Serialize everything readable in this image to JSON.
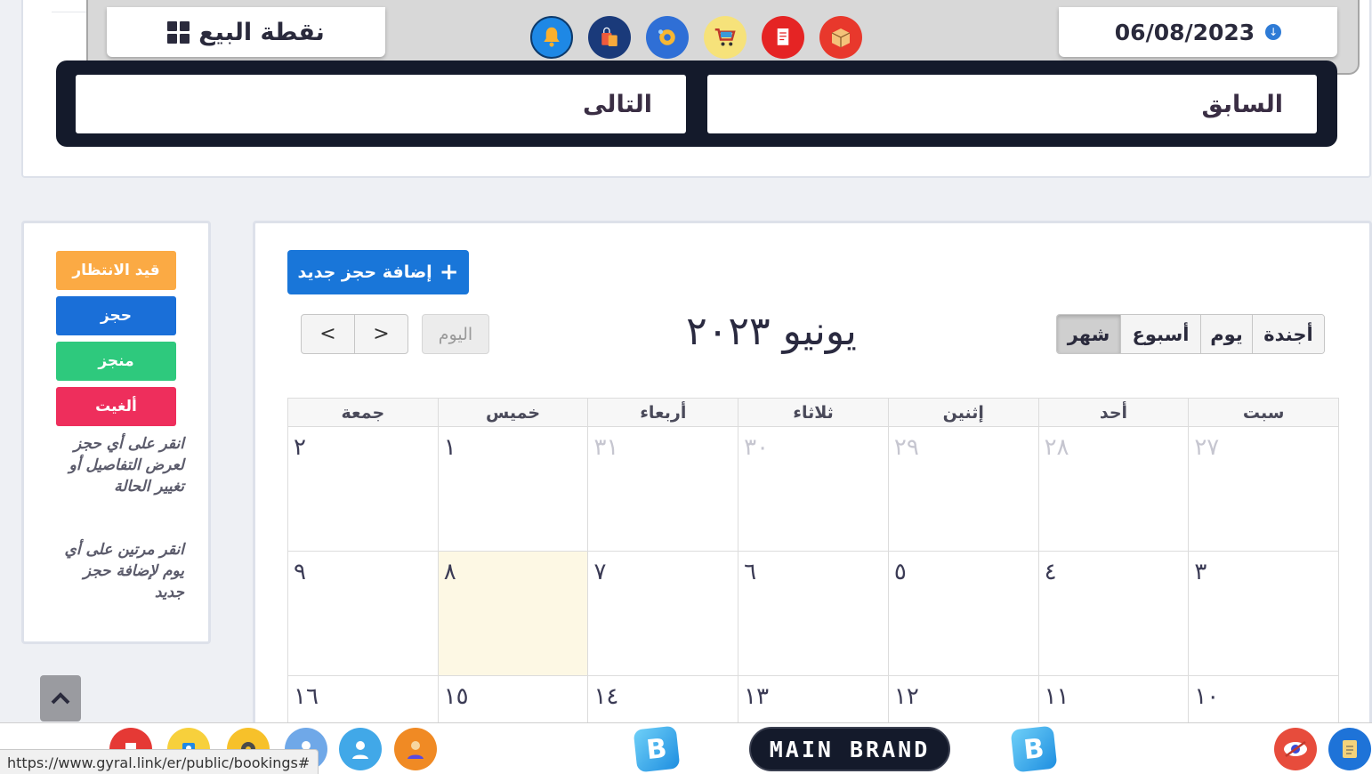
{
  "header": {
    "pos_label": "نقطة البيع",
    "date": "06/08/2023",
    "icons": [
      "bell-icon",
      "shopping-bags-icon",
      "settings-gear-icon",
      "shopping-cart-icon",
      "invoice-icon",
      "box-icon"
    ]
  },
  "nav": {
    "next_label": "التالى",
    "prev_label": "السابق"
  },
  "legend": {
    "statuses": [
      {
        "label": "قيد الانتظار",
        "color": "#fbaa44"
      },
      {
        "label": "حجز",
        "color": "#1a6fd8"
      },
      {
        "label": "منجز",
        "color": "#2ec97d"
      },
      {
        "label": "ألغيت",
        "color": "#ee2e5c"
      }
    ],
    "help_1": "انقر على أي حجز لعرض التفاصيل أو تغيير الحالة",
    "help_2": "انقر مرتين على أي يوم لإضافة حجز جديد"
  },
  "calendar": {
    "add_label": "إضافة حجز جديد",
    "today_label": "اليوم",
    "month_title": "يونيو ٢٠٢٣",
    "views": [
      "شهر",
      "أسبوع",
      "يوم",
      "أجندة"
    ],
    "active_view": "شهر",
    "weekdays": [
      "جمعة",
      "خميس",
      "أربعاء",
      "ثلاثاء",
      "إثنين",
      "أحد",
      "سبت"
    ],
    "weeks": [
      [
        "٢",
        "١",
        "٣١",
        "٣٠",
        "٢٩",
        "٢٨",
        "٢٧"
      ],
      [
        "٩",
        "٨",
        "٧",
        "٦",
        "٥",
        "٤",
        "٣"
      ],
      [
        "١٦",
        "١٥",
        "١٤",
        "١٣",
        "١٢",
        "١١",
        "١٠"
      ]
    ]
  },
  "taskbar": {
    "brand": "MAIN BRAND",
    "logo_letter": "B",
    "status_url": "https://www.gyral.link/er/public/bookings#"
  }
}
